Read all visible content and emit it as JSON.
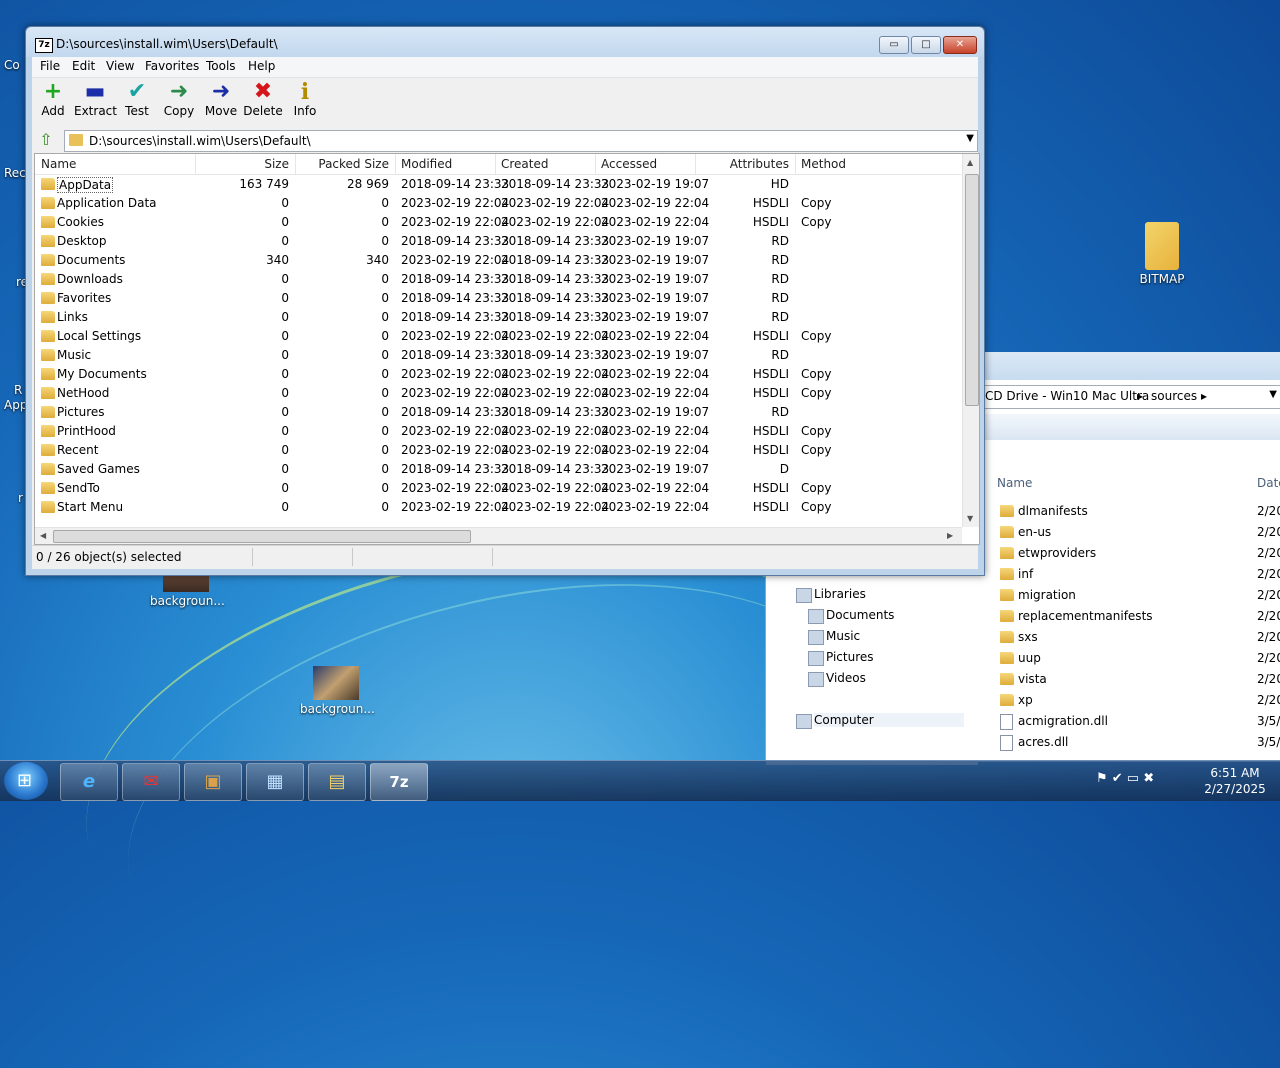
{
  "desktop": {
    "icons": [
      {
        "label": "BITMAP"
      },
      {
        "label": "backgroun..."
      },
      {
        "label": "backgroun..."
      }
    ],
    "partial_labels": [
      "Co",
      "Rec",
      "re",
      "R",
      "App",
      "r"
    ]
  },
  "window": {
    "title": "D:\\sources\\install.wim\\Users\\Default\\",
    "app_icon": "7z",
    "controls": {
      "minimize": "▭",
      "maximize": "□",
      "close": "✕"
    }
  },
  "menu": [
    "File",
    "Edit",
    "View",
    "Favorites",
    "Tools",
    "Help"
  ],
  "toolbar": [
    {
      "label": "Add",
      "icon": "+",
      "color": "#1fa81f"
    },
    {
      "label": "Extract",
      "icon": "▬",
      "color": "#1d2fa8"
    },
    {
      "label": "Test",
      "icon": "✔",
      "color": "#19a3a3"
    },
    {
      "label": "Copy",
      "icon": "➜",
      "color": "#2c8a4a"
    },
    {
      "label": "Move",
      "icon": "➜",
      "color": "#1d2fa8"
    },
    {
      "label": "Delete",
      "icon": "✖",
      "color": "#d4151a"
    },
    {
      "label": "Info",
      "icon": "i",
      "color": "#b38b00"
    }
  ],
  "address": {
    "path": "D:\\sources\\install.wim\\Users\\Default\\",
    "up_icon": "⇧",
    "dropdown": "▼"
  },
  "columns": [
    "Name",
    "Size",
    "Packed Size",
    "Modified",
    "Created",
    "Accessed",
    "Attributes",
    "Method"
  ],
  "rows": [
    [
      "AppData",
      "163 749",
      "28 969",
      "2018-09-14 23:33",
      "2018-09-14 23:33",
      "2023-02-19 19:07",
      "HD",
      ""
    ],
    [
      "Application Data",
      "0",
      "0",
      "2023-02-19 22:04",
      "2023-02-19 22:04",
      "2023-02-19 22:04",
      "HSDLI",
      "Copy"
    ],
    [
      "Cookies",
      "0",
      "0",
      "2023-02-19 22:04",
      "2023-02-19 22:04",
      "2023-02-19 22:04",
      "HSDLI",
      "Copy"
    ],
    [
      "Desktop",
      "0",
      "0",
      "2018-09-14 23:33",
      "2018-09-14 23:33",
      "2023-02-19 19:07",
      "RD",
      ""
    ],
    [
      "Documents",
      "340",
      "340",
      "2023-02-19 22:04",
      "2018-09-14 23:33",
      "2023-02-19 19:07",
      "RD",
      ""
    ],
    [
      "Downloads",
      "0",
      "0",
      "2018-09-14 23:33",
      "2018-09-14 23:33",
      "2023-02-19 19:07",
      "RD",
      ""
    ],
    [
      "Favorites",
      "0",
      "0",
      "2018-09-14 23:33",
      "2018-09-14 23:33",
      "2023-02-19 19:07",
      "RD",
      ""
    ],
    [
      "Links",
      "0",
      "0",
      "2018-09-14 23:33",
      "2018-09-14 23:33",
      "2023-02-19 19:07",
      "RD",
      ""
    ],
    [
      "Local Settings",
      "0",
      "0",
      "2023-02-19 22:04",
      "2023-02-19 22:04",
      "2023-02-19 22:04",
      "HSDLI",
      "Copy"
    ],
    [
      "Music",
      "0",
      "0",
      "2018-09-14 23:33",
      "2018-09-14 23:33",
      "2023-02-19 19:07",
      "RD",
      ""
    ],
    [
      "My Documents",
      "0",
      "0",
      "2023-02-19 22:04",
      "2023-02-19 22:04",
      "2023-02-19 22:04",
      "HSDLI",
      "Copy"
    ],
    [
      "NetHood",
      "0",
      "0",
      "2023-02-19 22:04",
      "2023-02-19 22:04",
      "2023-02-19 22:04",
      "HSDLI",
      "Copy"
    ],
    [
      "Pictures",
      "0",
      "0",
      "2018-09-14 23:33",
      "2018-09-14 23:33",
      "2023-02-19 19:07",
      "RD",
      ""
    ],
    [
      "PrintHood",
      "0",
      "0",
      "2023-02-19 22:04",
      "2023-02-19 22:04",
      "2023-02-19 22:04",
      "HSDLI",
      "Copy"
    ],
    [
      "Recent",
      "0",
      "0",
      "2023-02-19 22:04",
      "2023-02-19 22:04",
      "2023-02-19 22:04",
      "HSDLI",
      "Copy"
    ],
    [
      "Saved Games",
      "0",
      "0",
      "2018-09-14 23:33",
      "2018-09-14 23:33",
      "2023-02-19 19:07",
      "D",
      ""
    ],
    [
      "SendTo",
      "0",
      "0",
      "2023-02-19 22:04",
      "2023-02-19 22:04",
      "2023-02-19 22:04",
      "HSDLI",
      "Copy"
    ],
    [
      "Start Menu",
      "0",
      "0",
      "2023-02-19 22:04",
      "2023-02-19 22:04",
      "2023-02-19 22:04",
      "HSDLI",
      "Copy"
    ]
  ],
  "status": {
    "selection": "0 / 26 object(s) selected"
  },
  "explorer": {
    "breadcrumb": [
      "CD Drive - Win10 Mac Ultra",
      "sources"
    ],
    "columns": [
      "Name",
      "Date"
    ],
    "nav": [
      "Libraries",
      "Documents",
      "Music",
      "Pictures",
      "Videos",
      "Computer"
    ],
    "items": [
      {
        "name": "dlmanifests",
        "date": "2/20",
        "type": "folder"
      },
      {
        "name": "en-us",
        "date": "2/20",
        "type": "folder"
      },
      {
        "name": "etwproviders",
        "date": "2/20",
        "type": "folder"
      },
      {
        "name": "inf",
        "date": "2/20",
        "type": "folder"
      },
      {
        "name": "migration",
        "date": "2/20",
        "type": "folder"
      },
      {
        "name": "replacementmanifests",
        "date": "2/20",
        "type": "folder"
      },
      {
        "name": "sxs",
        "date": "2/20",
        "type": "folder"
      },
      {
        "name": "uup",
        "date": "2/20",
        "type": "folder"
      },
      {
        "name": "vista",
        "date": "2/20",
        "type": "folder"
      },
      {
        "name": "xp",
        "date": "2/20",
        "type": "folder"
      },
      {
        "name": "acmigration.dll",
        "date": "3/5/",
        "type": "file"
      },
      {
        "name": "acres.dll",
        "date": "3/5/",
        "type": "file"
      }
    ]
  },
  "taskbar": {
    "start_icon": "⊞",
    "apps": [
      {
        "name": "internet-explorer",
        "glyph": "e"
      },
      {
        "name": "gmail",
        "glyph": "✉"
      },
      {
        "name": "package",
        "glyph": "▣"
      },
      {
        "name": "control-panel",
        "glyph": "▦"
      },
      {
        "name": "file-explorer",
        "glyph": "▤"
      },
      {
        "name": "7zip",
        "glyph": "7z"
      }
    ],
    "tray_icons": "⚑ ✔ ▭ ✖",
    "time": "6:51 AM",
    "date": "2/27/2025"
  }
}
